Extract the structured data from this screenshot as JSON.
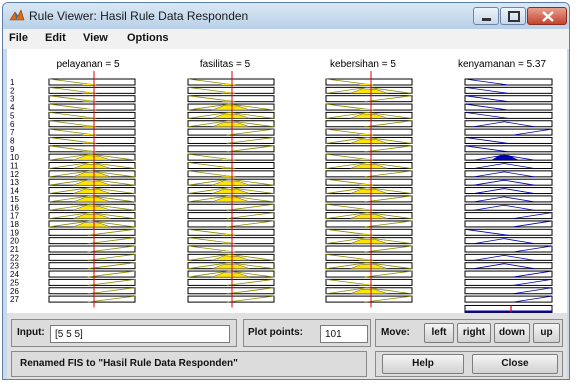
{
  "window": {
    "title": "Rule Viewer: Hasil Rule Data Responden",
    "icon": "matlab-icon",
    "controls": [
      "minimize-icon",
      "maximize-icon",
      "close-icon"
    ]
  },
  "menu": [
    "File",
    "Edit",
    "View",
    "Options"
  ],
  "inputs": [
    {
      "label": "pelayanan = 5"
    },
    {
      "label": "fasilitas = 5"
    },
    {
      "label": "kebersihan = 5"
    }
  ],
  "output": {
    "label": "kenyamanan = 5.37"
  },
  "rule_numbers": [
    "1",
    "2",
    "3",
    "4",
    "5",
    "6",
    "7",
    "8",
    "9",
    "10",
    "11",
    "12",
    "13",
    "14",
    "15",
    "16",
    "17",
    "18",
    "19",
    "20",
    "21",
    "22",
    "23",
    "24",
    "25",
    "26",
    "27"
  ],
  "colors": {
    "input_fill": "#ffe600",
    "input_line": "#8a8a00",
    "output_line": "#0000b4",
    "cursor": "#e00000",
    "title_bg": "#c8d9ec"
  },
  "input_mf": [
    [
      "low",
      "low",
      "low"
    ],
    [
      "low",
      "low",
      "med"
    ],
    [
      "low",
      "low",
      "high"
    ],
    [
      "low",
      "med",
      "low"
    ],
    [
      "low",
      "med",
      "med"
    ],
    [
      "low",
      "med",
      "high"
    ],
    [
      "low",
      "high",
      "low"
    ],
    [
      "low",
      "high",
      "med"
    ],
    [
      "low",
      "high",
      "high"
    ],
    [
      "med",
      "low",
      "low"
    ],
    [
      "med",
      "low",
      "med"
    ],
    [
      "med",
      "low",
      "high"
    ],
    [
      "med",
      "med",
      "low"
    ],
    [
      "med",
      "med",
      "med"
    ],
    [
      "med",
      "med",
      "high"
    ],
    [
      "med",
      "high",
      "low"
    ],
    [
      "med",
      "high",
      "med"
    ],
    [
      "med",
      "high",
      "high"
    ],
    [
      "high",
      "low",
      "low"
    ],
    [
      "high",
      "low",
      "med"
    ],
    [
      "high",
      "low",
      "high"
    ],
    [
      "high",
      "med",
      "low"
    ],
    [
      "high",
      "med",
      "med"
    ],
    [
      "high",
      "med",
      "high"
    ],
    [
      "high",
      "high",
      "low"
    ],
    [
      "high",
      "high",
      "med"
    ],
    [
      "high",
      "high",
      "high"
    ]
  ],
  "output_mf": [
    "low",
    "low",
    "low",
    "low",
    "low",
    "med",
    "high",
    "low",
    "low",
    "med",
    "med",
    "med",
    "med",
    "med",
    "med",
    "med",
    "high",
    "high",
    "low",
    "med",
    "high",
    "med",
    "med",
    "high",
    "high",
    "high",
    "high"
  ],
  "output_fired": [
    10
  ],
  "controls": {
    "input_label": "Input:",
    "input_value": "[5 5 5]",
    "plot_points_label": "Plot points:",
    "plot_points_value": "101",
    "move_label": "Move:",
    "buttons": {
      "left": "left",
      "right": "right",
      "down": "down",
      "up": "up",
      "help": "Help",
      "close": "Close"
    },
    "status": "Renamed FIS to \"Hasil Rule Data Responden\""
  }
}
